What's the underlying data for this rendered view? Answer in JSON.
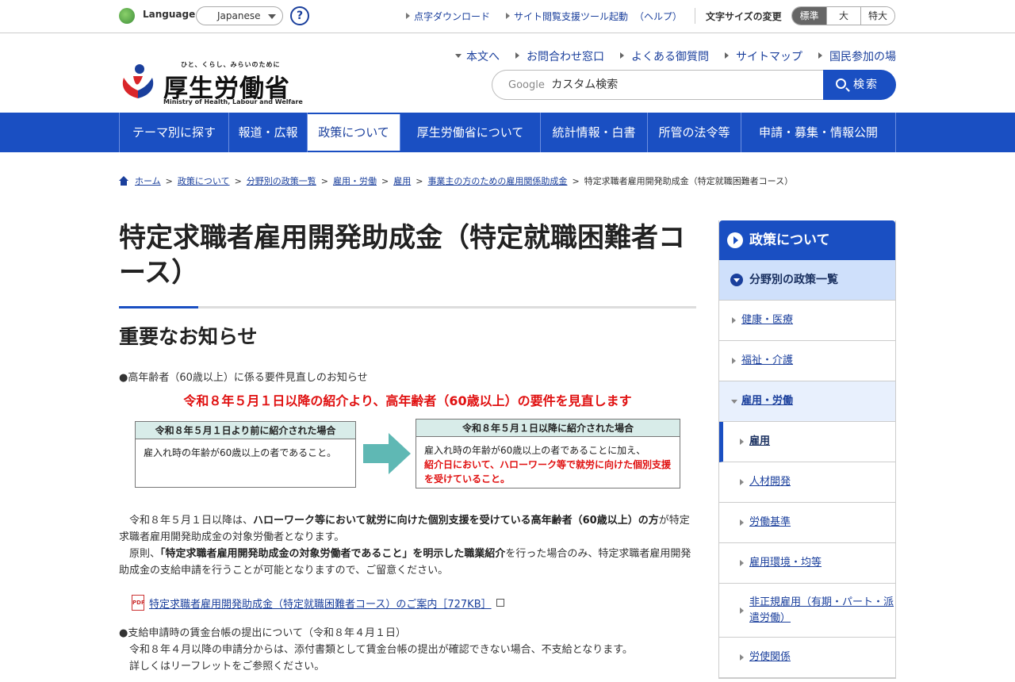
{
  "topbar": {
    "language_label": "Language",
    "language_value": "Japanese",
    "help_symbol": "?",
    "links": [
      "点字ダウンロード",
      "サイト閲覧支援ツール起動"
    ],
    "help_link": "（ヘルプ）",
    "fontsize_label": "文字サイズの変更",
    "fontsize_options": [
      "標準",
      "大",
      "特大"
    ]
  },
  "header": {
    "logo_tagline": "ひと、くらし、みらいのために",
    "logo_name": "厚生労働省",
    "logo_en": "Ministry of Health, Labour and Welfare",
    "links": [
      "本文へ",
      "お問合わせ窓口",
      "よくある御質問",
      "サイトマップ",
      "国民参加の場"
    ],
    "search_google": "Google",
    "search_placeholder": "カスタム検索",
    "search_button": "検索"
  },
  "gnav": [
    "テーマ別に探す",
    "報道・広報",
    "政策について",
    "厚生労働省について",
    "統計情報・白書",
    "所管の法令等",
    "申請・募集・情報公開"
  ],
  "breadcrumb": {
    "links": [
      "ホーム",
      "政策について",
      "分野別の政策一覧",
      "雇用・労働",
      "雇用",
      "事業主の方のための雇用関係助成金"
    ],
    "current": "特定求職者雇用開発助成金（特定就職困難者コース）"
  },
  "main": {
    "title": "特定求職者雇用開発助成金（特定就職困難者コース）",
    "section_title": "重要なお知らせ",
    "notice1": "●高年齢者（60歳以上）に係る要件見直しのお知らせ",
    "red_heading": "令和８年５月１日以降の紹介より、高年齢者（60歳以上）の要件を見直します",
    "box_left_head": "令和８年５月１日より前に紹介された場合",
    "box_left_body": "雇入れ時の年齢が60歳以上の者であること。",
    "box_right_head": "令和８年５月１日以降に紹介された場合",
    "box_right_body": "雇入れ時の年齢が60歳以上の者であることに加え、",
    "box_right_red": "紹介日において、ハローワーク等で就労に向けた個別支援を受けていること。",
    "p1_a": "令和８年５月１日以降は、",
    "p1_b": "ハローワーク等において就労に向けた個別支援を受けている高年齢者（60歳以上）の方",
    "p1_c": "が特定求職者雇用開発助成金の対象労働者となります。",
    "p2_a": "原則、",
    "p2_b": "「特定求職者雇用開発助成金の対象労働者であること」を明示した職業紹介",
    "p2_c": "を行った場合のみ、特定求職者雇用開発助成金の支給申請を行うことが可能となりますので、ご留意ください。",
    "pdf_label": "PDF",
    "pdf_link": "特定求職者雇用開発助成金（特定就職困難者コース）のご案内［727KB］",
    "notice2": "●支給申請時の賃金台帳の提出について（令和８年４月１日）",
    "notice2_l1": "令和８年４月以降の申請分からは、添付書類として賃金台帳の提出が確認できない場合、不支給となります。",
    "notice2_l2": "詳しくはリーフレットをご参照ください。"
  },
  "side": {
    "head": "政策について",
    "sub": "分野別の政策一覧",
    "items": [
      "健康・医療",
      "福祉・介護",
      "雇用・労働"
    ],
    "sub_items": [
      "雇用",
      "人材開発",
      "労働基準",
      "雇用環境・均等",
      "非正規雇用（有期・パート・派遣労働）",
      "労使関係"
    ]
  },
  "colors": {
    "brand_blue": "#1a4fc2",
    "alert_red": "#e01010",
    "box_head_teal": "#d8ece9",
    "arrow_teal": "#5fb8b4"
  }
}
